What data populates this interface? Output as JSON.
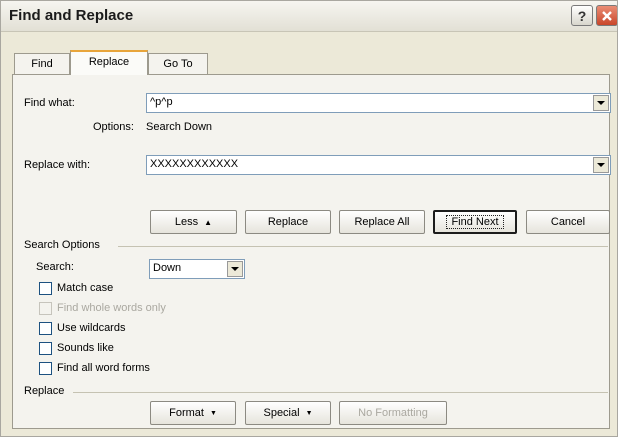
{
  "window": {
    "title": "Find and Replace"
  },
  "tabs": [
    "Find",
    "Replace",
    "Go To"
  ],
  "find": {
    "label": "Find what:",
    "value": "^p^p",
    "options_label": "Options:",
    "options_value": "Search Down"
  },
  "replace": {
    "label": "Replace with:",
    "value": "XXXXXXXXXXXX"
  },
  "buttons": {
    "less": "Less",
    "replace": "Replace",
    "replace_all": "Replace All",
    "find_next": "Find Next",
    "cancel": "Cancel"
  },
  "search_options": {
    "title": "Search Options",
    "search_label": "Search:",
    "search_value": "Down",
    "checkboxes": [
      {
        "label": "Match case",
        "checked": false,
        "enabled": true
      },
      {
        "label": "Find whole words only",
        "checked": false,
        "enabled": false
      },
      {
        "label": "Use wildcards",
        "checked": false,
        "enabled": true
      },
      {
        "label": "Sounds like",
        "checked": false,
        "enabled": true
      },
      {
        "label": "Find all word forms",
        "checked": false,
        "enabled": true
      }
    ]
  },
  "replace_section": {
    "title": "Replace",
    "format": "Format",
    "special": "Special",
    "no_formatting": "No Formatting"
  }
}
